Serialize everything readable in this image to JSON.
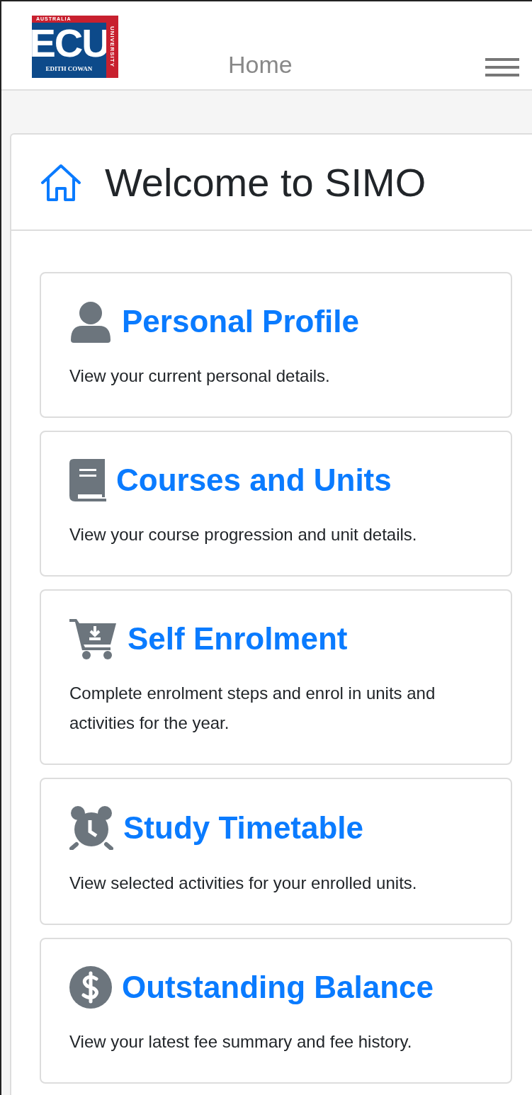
{
  "header": {
    "logo": {
      "top": "AUSTRALIA",
      "main": "ECU",
      "bottom": "EDITH COWAN",
      "side": "UNIVERSITY"
    },
    "title": "Home"
  },
  "panel": {
    "title": "Welcome to SIMO"
  },
  "cards": [
    {
      "kind": "person",
      "title": "Personal Profile",
      "description": "View your current personal details."
    },
    {
      "kind": "book",
      "title": "Courses and Units",
      "description": "View your course progression and unit details."
    },
    {
      "kind": "cart",
      "title": "Self Enrolment",
      "description": "Complete enrolment steps and enrol in units and activities for the year."
    },
    {
      "kind": "alarm",
      "title": "Study Timetable",
      "description": "View selected activities for your enrolled units."
    },
    {
      "kind": "dollar",
      "title": "Outstanding Balance",
      "description": "View your latest fee summary and fee history."
    }
  ]
}
